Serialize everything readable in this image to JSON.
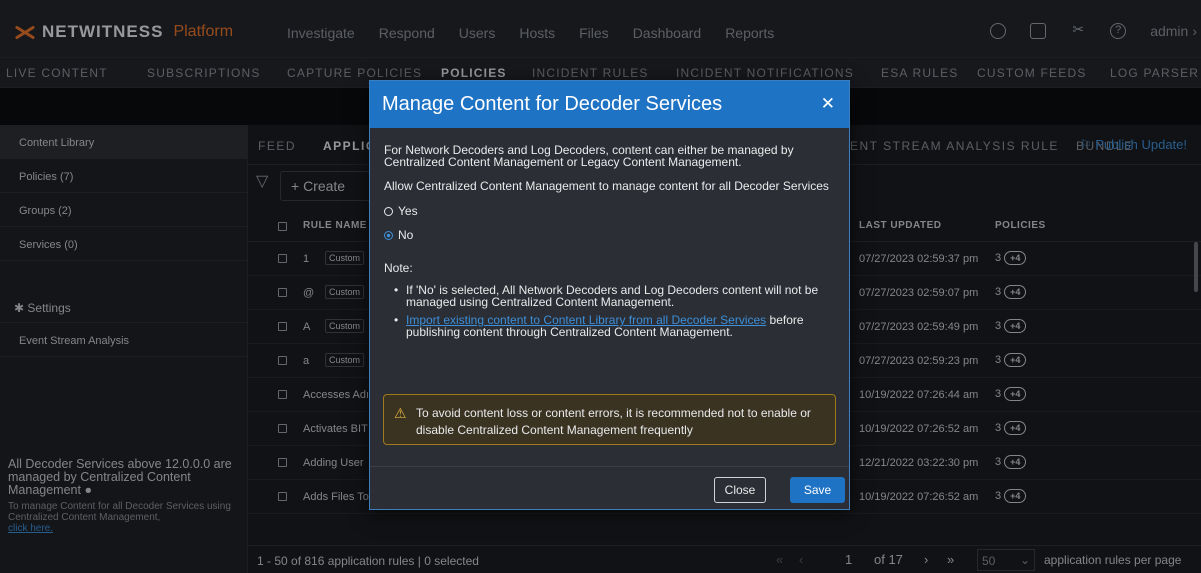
{
  "topnav": {
    "brand": "NETWITNESS",
    "platform": "Platform",
    "items": [
      "Investigate",
      "Respond",
      "Users",
      "Hosts",
      "Files",
      "Dashboard",
      "Reports"
    ],
    "user": "admin",
    "icons": [
      "timer-icon",
      "notes-icon",
      "tools-icon",
      "help-icon"
    ]
  },
  "subnav": {
    "items": [
      "LIVE CONTENT",
      "SUBSCRIPTIONS",
      "CAPTURE POLICIES",
      "POLICIES",
      "INCIDENT RULES",
      "INCIDENT NOTIFICATIONS",
      "ESA RULES",
      "CUSTOM FEEDS",
      "LOG PARSER"
    ],
    "active": "POLICIES"
  },
  "sidebar": {
    "items": [
      "Content Library",
      "Policies (7)",
      "Groups (2)",
      "Services (0)"
    ],
    "settings": "Settings",
    "settings_items": [
      "Event Stream Analysis"
    ],
    "footer_title": "All Decoder Services above 12.0.0.0 are managed by Centralized Content Management",
    "footer_text": "To manage Content for all Decoder Services using Centralized Content Management,",
    "footer_link": "click here."
  },
  "tabs": {
    "feed": "FEED",
    "application": "APPLIC",
    "esa": "ENT STREAM ANALYSIS RULE",
    "bundle": "BUNDLE",
    "publish": "Publish Update!"
  },
  "toolbar": {
    "create_label": "+ Create"
  },
  "table": {
    "headers": {
      "rule_name": "RULE NAME",
      "last_updated": "LAST UPDATED",
      "policies": "POLICIES"
    },
    "rows": [
      {
        "name": "1",
        "tag": "Custom",
        "date": "07/27/2023 02:59:37 pm",
        "policies": "3",
        "more": "+4"
      },
      {
        "name": "@",
        "tag": "Custom",
        "date": "07/27/2023 02:59:07 pm",
        "policies": "3",
        "more": "+4"
      },
      {
        "name": "A",
        "tag": "Custom",
        "date": "07/27/2023 02:59:49 pm",
        "policies": "3",
        "more": "+4"
      },
      {
        "name": "a",
        "tag": "Custom",
        "date": "07/27/2023 02:59:23 pm",
        "policies": "3",
        "more": "+4"
      },
      {
        "name": "Accesses Adı",
        "tag": "",
        "date": "10/19/2022 07:26:44 am",
        "policies": "3",
        "more": "+4"
      },
      {
        "name": "Activates BIT",
        "tag": "",
        "date": "10/19/2022 07:26:52 am",
        "policies": "3",
        "more": "+4"
      },
      {
        "name": "Adding User",
        "tag": "",
        "date": "12/21/2022 03:22:30 pm",
        "policies": "3",
        "more": "+4"
      },
      {
        "name": "Adds Files To",
        "tag": "",
        "date": "10/19/2022 07:26:52 am",
        "policies": "3",
        "more": "+4"
      }
    ]
  },
  "footer": {
    "summary": "1 - 50 of 816 application rules | 0 selected",
    "page": "1",
    "of_pages": "of 17",
    "per_page": "50",
    "per_page_label": "application rules per page"
  },
  "modal": {
    "title": "Manage Content for Decoder Services",
    "intro": "For Network Decoders and Log Decoders, content can either be managed by Centralized Content Management or Legacy Content Management.",
    "question": "Allow Centralized Content Management to manage content for all Decoder Services",
    "option_yes": "Yes",
    "option_no": "No",
    "note_label": "Note:",
    "bullet1": "If 'No' is selected, All Network Decoders and Log Decoders content will not be managed using Centralized Content Management.",
    "bullet2_link": "Import existing content to Content Library from all Decoder Services",
    "bullet2_rest": "before publishing content through Centralized Content Management.",
    "warning": "To avoid content loss or content errors, it is recommended not to enable or disable Centralized Content Management frequently",
    "close_label": "Close",
    "save_label": "Save"
  }
}
